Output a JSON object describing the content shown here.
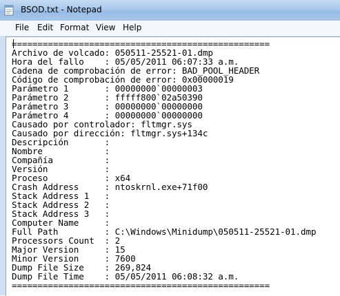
{
  "window": {
    "title": "BSOD.txt - Notepad"
  },
  "menu": [
    "File",
    "Edit",
    "Format",
    "View",
    "Help"
  ],
  "document": {
    "lines": [
      "==================================================",
      "Archivo de volcado: 050511-25521-01.dmp",
      "Hora del fallo    : 05/05/2011 06:07:33 a.m.",
      "Cadena de comprobación de error: BAD_POOL_HEADER",
      "Código de comprobación de error: 0x00000019",
      "Parámetro 1       : 00000000`00000003",
      "Parámetro 2       : fffff800`02a50390",
      "Parámetro 3       : 00000000`00000000",
      "Parámetro 4       : 00000000`00000000",
      "Causado por controlador: fltmgr.sys",
      "Causado por dirección: fltmgr.sys+134c",
      "Descripción       :",
      "Nombre            :",
      "Compañía          :",
      "Versión           :",
      "Proceso           : x64",
      "Crash Address     : ntoskrnl.exe+71f00",
      "Stack Address 1   :",
      "Stack Address 2   :",
      "Stack Address 3   :",
      "Computer Name     :",
      "Full Path         : C:\\Windows\\Minidump\\050511-25521-01.dmp",
      "Processors Count  : 2",
      "Major Version     : 15",
      "Minor Version     : 7600",
      "Dump File Size    : 269,824",
      "Dump File Time    : 05/05/2011 06:08:32 a.m.",
      "=================================================="
    ]
  }
}
